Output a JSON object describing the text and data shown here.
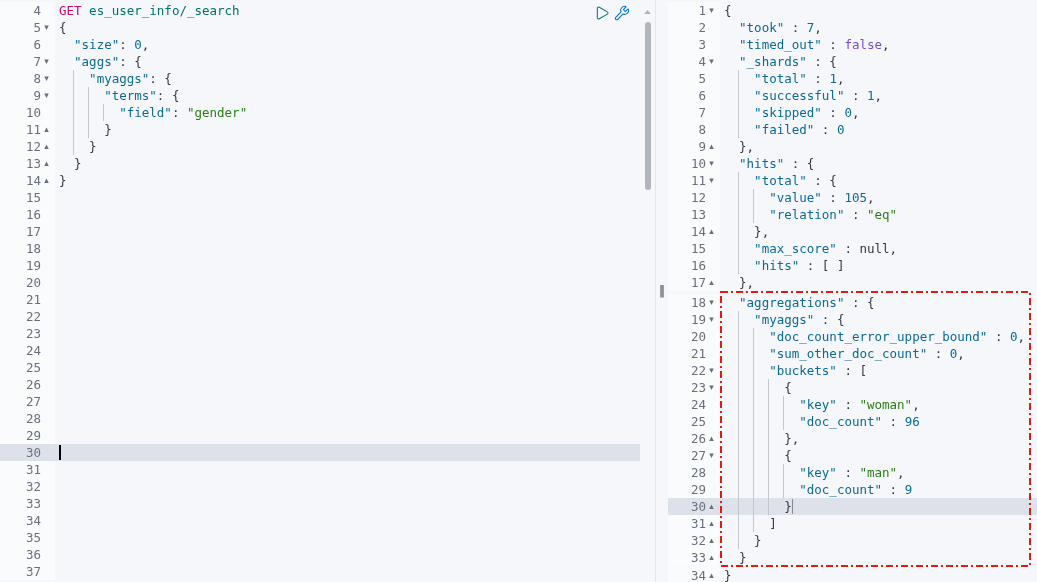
{
  "request_editor": {
    "lines": [
      {
        "kind": "line",
        "number": "4",
        "highlighted": false,
        "cursor": false,
        "tokens": [
          {
            "kind": "method",
            "text": "GET"
          },
          {
            "kind": "url",
            "text": " es_user_info/_search"
          }
        ]
      },
      {
        "kind": "line",
        "number": "5",
        "fold": "▾",
        "highlighted": false,
        "cursor": false,
        "tokens": [
          {
            "kind": "punct",
            "text": "{"
          }
        ]
      },
      {
        "kind": "line",
        "number": "6",
        "highlighted": false,
        "cursor": false,
        "tokens": [
          {
            "kind": "key",
            "text": "  \"size\""
          },
          {
            "kind": "punct",
            "text": ": "
          },
          {
            "kind": "number",
            "text": "0"
          },
          {
            "kind": "punct",
            "text": ","
          }
        ]
      },
      {
        "kind": "line",
        "number": "7",
        "fold": "▾",
        "highlighted": false,
        "cursor": false,
        "tokens": [
          {
            "kind": "key",
            "text": "  \"aggs\""
          },
          {
            "kind": "punct",
            "text": ": {"
          }
        ]
      },
      {
        "kind": "line",
        "number": "8",
        "fold": "▾",
        "highlighted": false,
        "cursor": false,
        "tokens": [
          {
            "kind": "key",
            "text": "    \"myaggs\""
          },
          {
            "kind": "punct",
            "text": ": {"
          }
        ]
      },
      {
        "kind": "line",
        "number": "9",
        "fold": "▾",
        "highlighted": false,
        "cursor": false,
        "tokens": [
          {
            "kind": "key",
            "text": "      \"terms\""
          },
          {
            "kind": "punct",
            "text": ": {"
          }
        ]
      },
      {
        "kind": "line",
        "number": "10",
        "highlighted": false,
        "cursor": false,
        "tokens": [
          {
            "kind": "key",
            "text": "        \"field\""
          },
          {
            "kind": "punct",
            "text": ": "
          },
          {
            "kind": "string",
            "text": "\"gender\""
          }
        ]
      },
      {
        "kind": "line",
        "number": "11",
        "fold": "▴",
        "highlighted": false,
        "cursor": false,
        "tokens": [
          {
            "kind": "punct",
            "text": "      }"
          }
        ]
      },
      {
        "kind": "line",
        "number": "12",
        "fold": "▴",
        "highlighted": false,
        "cursor": false,
        "tokens": [
          {
            "kind": "punct",
            "text": "    }"
          }
        ]
      },
      {
        "kind": "line",
        "number": "13",
        "fold": "▴",
        "highlighted": false,
        "cursor": false,
        "tokens": [
          {
            "kind": "punct",
            "text": "  }"
          }
        ]
      },
      {
        "kind": "line",
        "number": "14",
        "fold": "▴",
        "highlighted": false,
        "cursor": false,
        "tokens": [
          {
            "kind": "punct",
            "text": "}"
          }
        ]
      },
      {
        "kind": "line",
        "number": "15",
        "highlighted": false,
        "cursor": false
      },
      {
        "kind": "line",
        "number": "16",
        "highlighted": false,
        "cursor": false
      },
      {
        "kind": "line",
        "number": "17",
        "highlighted": false,
        "cursor": false
      },
      {
        "kind": "line",
        "number": "18",
        "highlighted": false,
        "cursor": false
      },
      {
        "kind": "line",
        "number": "19",
        "highlighted": false,
        "cursor": false
      },
      {
        "kind": "line",
        "number": "20",
        "highlighted": false,
        "cursor": false
      },
      {
        "kind": "line",
        "number": "21",
        "highlighted": false,
        "cursor": false
      },
      {
        "kind": "line",
        "number": "22",
        "highlighted": false,
        "cursor": false
      },
      {
        "kind": "line",
        "number": "23",
        "highlighted": false,
        "cursor": false
      },
      {
        "kind": "line",
        "number": "24",
        "highlighted": false,
        "cursor": false
      },
      {
        "kind": "line",
        "number": "25",
        "highlighted": false,
        "cursor": false
      },
      {
        "kind": "line",
        "number": "26",
        "highlighted": false,
        "cursor": false
      },
      {
        "kind": "line",
        "number": "27",
        "highlighted": false,
        "cursor": false
      },
      {
        "kind": "line",
        "number": "28",
        "highlighted": false,
        "cursor": false
      },
      {
        "kind": "line",
        "number": "29",
        "highlighted": false,
        "cursor": false
      },
      {
        "kind": "line",
        "number": "30",
        "highlighted": true,
        "cursor": true
      },
      {
        "kind": "line",
        "number": "31",
        "highlighted": false,
        "cursor": false
      },
      {
        "kind": "line",
        "number": "32",
        "highlighted": false,
        "cursor": false
      },
      {
        "kind": "line",
        "number": "33",
        "highlighted": false,
        "cursor": false
      },
      {
        "kind": "line",
        "number": "34",
        "highlighted": false,
        "cursor": false
      },
      {
        "kind": "line",
        "number": "35",
        "highlighted": false,
        "cursor": false
      },
      {
        "kind": "line",
        "number": "36",
        "highlighted": false,
        "cursor": false
      },
      {
        "kind": "line",
        "number": "37",
        "highlighted": false,
        "cursor": false
      }
    ]
  },
  "divider": {
    "handle": "‖"
  },
  "response_viewer": {
    "lines": [
      {
        "kind": "line",
        "number": "1",
        "fold": "▾",
        "highlighted": false,
        "cursor": false,
        "tokens": [
          {
            "kind": "punct",
            "text": "{"
          }
        ]
      },
      {
        "kind": "line",
        "number": "2",
        "highlighted": false,
        "cursor": false,
        "tokens": [
          {
            "kind": "key",
            "text": "  \"took\""
          },
          {
            "kind": "punct",
            "text": " : "
          },
          {
            "kind": "number",
            "text": "7"
          },
          {
            "kind": "punct",
            "text": ","
          }
        ]
      },
      {
        "kind": "line",
        "number": "3",
        "highlighted": false,
        "cursor": false,
        "tokens": [
          {
            "kind": "key",
            "text": "  \"timed_out\""
          },
          {
            "kind": "punct",
            "text": " : "
          },
          {
            "kind": "bool",
            "text": "false"
          },
          {
            "kind": "punct",
            "text": ","
          }
        ]
      },
      {
        "kind": "line",
        "number": "4",
        "fold": "▾",
        "highlighted": false,
        "cursor": false,
        "tokens": [
          {
            "kind": "key",
            "text": "  \"_shards\""
          },
          {
            "kind": "punct",
            "text": " : {"
          }
        ]
      },
      {
        "kind": "line",
        "number": "5",
        "highlighted": false,
        "cursor": false,
        "tokens": [
          {
            "kind": "key",
            "text": "    \"total\""
          },
          {
            "kind": "punct",
            "text": " : "
          },
          {
            "kind": "number",
            "text": "1"
          },
          {
            "kind": "punct",
            "text": ","
          }
        ]
      },
      {
        "kind": "line",
        "number": "6",
        "highlighted": false,
        "cursor": false,
        "tokens": [
          {
            "kind": "key",
            "text": "    \"successful\""
          },
          {
            "kind": "punct",
            "text": " : "
          },
          {
            "kind": "number",
            "text": "1"
          },
          {
            "kind": "punct",
            "text": ","
          }
        ]
      },
      {
        "kind": "line",
        "number": "7",
        "highlighted": false,
        "cursor": false,
        "tokens": [
          {
            "kind": "key",
            "text": "    \"skipped\""
          },
          {
            "kind": "punct",
            "text": " : "
          },
          {
            "kind": "number",
            "text": "0"
          },
          {
            "kind": "punct",
            "text": ","
          }
        ]
      },
      {
        "kind": "line",
        "number": "8",
        "highlighted": false,
        "cursor": false,
        "tokens": [
          {
            "kind": "key",
            "text": "    \"failed\""
          },
          {
            "kind": "punct",
            "text": " : "
          },
          {
            "kind": "number",
            "text": "0"
          }
        ]
      },
      {
        "kind": "line",
        "number": "9",
        "fold": "▴",
        "highlighted": false,
        "cursor": false,
        "tokens": [
          {
            "kind": "punct",
            "text": "  },"
          }
        ]
      },
      {
        "kind": "line",
        "number": "10",
        "fold": "▾",
        "highlighted": false,
        "cursor": false,
        "tokens": [
          {
            "kind": "key",
            "text": "  \"hits\""
          },
          {
            "kind": "punct",
            "text": " : {"
          }
        ]
      },
      {
        "kind": "line",
        "number": "11",
        "fold": "▾",
        "highlighted": false,
        "cursor": false,
        "tokens": [
          {
            "kind": "key",
            "text": "    \"total\""
          },
          {
            "kind": "punct",
            "text": " : {"
          }
        ]
      },
      {
        "kind": "line",
        "number": "12",
        "highlighted": false,
        "cursor": false,
        "tokens": [
          {
            "kind": "key",
            "text": "      \"value\""
          },
          {
            "kind": "punct",
            "text": " : "
          },
          {
            "kind": "number",
            "text": "105"
          },
          {
            "kind": "punct",
            "text": ","
          }
        ]
      },
      {
        "kind": "line",
        "number": "13",
        "highlighted": false,
        "cursor": false,
        "tokens": [
          {
            "kind": "key",
            "text": "      \"relation\""
          },
          {
            "kind": "punct",
            "text": " : "
          },
          {
            "kind": "string",
            "text": "\"eq\""
          }
        ]
      },
      {
        "kind": "line",
        "number": "14",
        "fold": "▴",
        "highlighted": false,
        "cursor": false,
        "tokens": [
          {
            "kind": "punct",
            "text": "    },"
          }
        ]
      },
      {
        "kind": "line",
        "number": "15",
        "highlighted": false,
        "cursor": false,
        "tokens": [
          {
            "kind": "key",
            "text": "    \"max_score\""
          },
          {
            "kind": "punct",
            "text": " : "
          },
          {
            "kind": "null",
            "text": "null"
          },
          {
            "kind": "punct",
            "text": ","
          }
        ]
      },
      {
        "kind": "line",
        "number": "16",
        "highlighted": false,
        "cursor": false,
        "tokens": [
          {
            "kind": "key",
            "text": "    \"hits\""
          },
          {
            "kind": "punct",
            "text": " : [ ]"
          }
        ]
      },
      {
        "kind": "line",
        "number": "17",
        "fold": "▴",
        "highlighted": false,
        "cursor": false,
        "tokens": [
          {
            "kind": "punct",
            "text": "  },"
          }
        ]
      },
      {
        "kind": "frame",
        "lines": [
          {
            "kind": "line",
            "number": "18",
            "fold": "▾",
            "highlighted": false,
            "cursor": false,
            "tokens": [
              {
                "kind": "key",
                "text": "  \"aggregations\""
              },
              {
                "kind": "punct",
                "text": " : {"
              }
            ]
          },
          {
            "kind": "line",
            "number": "19",
            "fold": "▾",
            "highlighted": false,
            "cursor": false,
            "tokens": [
              {
                "kind": "key",
                "text": "    \"myaggs\""
              },
              {
                "kind": "punct",
                "text": " : {"
              }
            ]
          },
          {
            "kind": "line",
            "number": "20",
            "highlighted": false,
            "cursor": false,
            "tokens": [
              {
                "kind": "key",
                "text": "      \"doc_count_error_upper_bound\""
              },
              {
                "kind": "punct",
                "text": " : "
              },
              {
                "kind": "number",
                "text": "0"
              },
              {
                "kind": "punct",
                "text": ","
              }
            ]
          },
          {
            "kind": "line",
            "number": "21",
            "highlighted": false,
            "cursor": false,
            "tokens": [
              {
                "kind": "key",
                "text": "      \"sum_other_doc_count\""
              },
              {
                "kind": "punct",
                "text": " : "
              },
              {
                "kind": "number",
                "text": "0"
              },
              {
                "kind": "punct",
                "text": ","
              }
            ]
          },
          {
            "kind": "line",
            "number": "22",
            "fold": "▾",
            "highlighted": false,
            "cursor": false,
            "tokens": [
              {
                "kind": "key",
                "text": "      \"buckets\""
              },
              {
                "kind": "punct",
                "text": " : ["
              }
            ]
          },
          {
            "kind": "line",
            "number": "23",
            "fold": "▾",
            "highlighted": false,
            "cursor": false,
            "tokens": [
              {
                "kind": "punct",
                "text": "        {"
              }
            ]
          },
          {
            "kind": "line",
            "number": "24",
            "highlighted": false,
            "cursor": false,
            "tokens": [
              {
                "kind": "key",
                "text": "          \"key\""
              },
              {
                "kind": "punct",
                "text": " : "
              },
              {
                "kind": "string",
                "text": "\"woman\""
              },
              {
                "kind": "punct",
                "text": ","
              }
            ]
          },
          {
            "kind": "line",
            "number": "25",
            "highlighted": false,
            "cursor": false,
            "tokens": [
              {
                "kind": "key",
                "text": "          \"doc_count\""
              },
              {
                "kind": "punct",
                "text": " : "
              },
              {
                "kind": "number",
                "text": "96"
              }
            ]
          },
          {
            "kind": "line",
            "number": "26",
            "fold": "▴",
            "highlighted": false,
            "cursor": false,
            "tokens": [
              {
                "kind": "punct",
                "text": "        },"
              }
            ]
          },
          {
            "kind": "line",
            "number": "27",
            "fold": "▾",
            "highlighted": false,
            "cursor": false,
            "tokens": [
              {
                "kind": "punct",
                "text": "        {"
              }
            ]
          },
          {
            "kind": "line",
            "number": "28",
            "highlighted": false,
            "cursor": false,
            "tokens": [
              {
                "kind": "key",
                "text": "          \"key\""
              },
              {
                "kind": "punct",
                "text": " : "
              },
              {
                "kind": "string",
                "text": "\"man\""
              },
              {
                "kind": "punct",
                "text": ","
              }
            ]
          },
          {
            "kind": "line",
            "number": "29",
            "highlighted": false,
            "cursor": false,
            "tokens": [
              {
                "kind": "key",
                "text": "          \"doc_count\""
              },
              {
                "kind": "punct",
                "text": " : "
              },
              {
                "kind": "number",
                "text": "9"
              }
            ]
          },
          {
            "kind": "line",
            "number": "30",
            "fold": "▴",
            "highlighted": true,
            "cursor": true,
            "tokens": [
              {
                "kind": "punct",
                "text": "        }"
              }
            ]
          },
          {
            "kind": "line",
            "number": "31",
            "fold": "▴",
            "highlighted": false,
            "cursor": false,
            "tokens": [
              {
                "kind": "punct",
                "text": "      ]"
              }
            ]
          },
          {
            "kind": "line",
            "number": "32",
            "fold": "▴",
            "highlighted": false,
            "cursor": false,
            "tokens": [
              {
                "kind": "punct",
                "text": "    }"
              }
            ]
          },
          {
            "kind": "line",
            "number": "33",
            "fold": "▴",
            "highlighted": false,
            "cursor": false,
            "tokens": [
              {
                "kind": "punct",
                "text": "  }"
              }
            ]
          }
        ]
      },
      {
        "kind": "line",
        "number": "34",
        "fold": "▴",
        "highlighted": false,
        "cursor": false,
        "tokens": [
          {
            "kind": "punct",
            "text": "}"
          }
        ]
      }
    ]
  }
}
